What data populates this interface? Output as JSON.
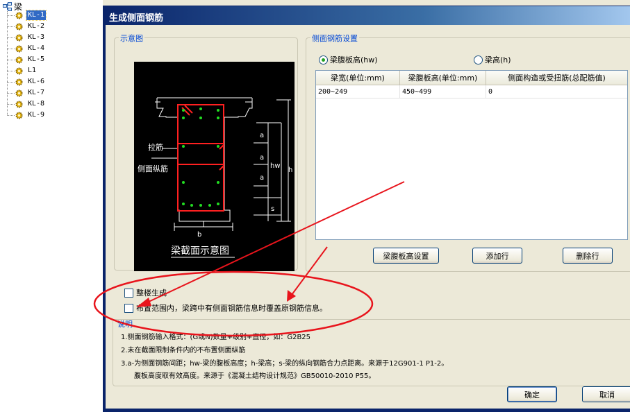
{
  "tree": {
    "root_label": "梁",
    "items": [
      {
        "label": "KL-1",
        "selected": true
      },
      {
        "label": "KL-2"
      },
      {
        "label": "KL-3"
      },
      {
        "label": "KL-4"
      },
      {
        "label": "KL-5"
      },
      {
        "label": "L1"
      },
      {
        "label": "KL-6"
      },
      {
        "label": "KL-7"
      },
      {
        "label": "KL-8"
      },
      {
        "label": "KL-9"
      }
    ]
  },
  "dialog": {
    "title": "生成侧面钢筋",
    "schematic": {
      "group_title": "示意图",
      "label_tie": "拉筋",
      "label_side_bar": "侧面纵筋",
      "caption": "梁截面示意图",
      "dim_a": "a",
      "dim_hw": "hw",
      "dim_h": "h",
      "dim_s": "s",
      "dim_b": "b"
    },
    "settings": {
      "group_title": "侧面钢筋设置",
      "radio_web_height": "梁腹板高(hw)",
      "radio_beam_height": "梁高(h)",
      "selected_radio": "web_height",
      "table": {
        "headers": [
          "梁宽(单位:mm)",
          "梁腹板高(单位:mm)",
          "侧面构造或受扭筋(总配筋值)"
        ],
        "rows": [
          [
            "200~249",
            "450~499",
            "0"
          ]
        ]
      },
      "btn_web_height_setting": "梁腹板高设置",
      "btn_add_row": "添加行",
      "btn_delete_row": "删除行"
    },
    "options": {
      "whole_floor": "整楼生成",
      "overwrite": "布置范围内，梁跨中有侧面钢筋信息时覆盖原钢筋信息。"
    },
    "notes": {
      "title": "说明",
      "lines": [
        "1.侧面钢筋输入格式：(G或N)数量+级别+直径，如：G2B25",
        "2.未在截面限制条件内的不布置侧面纵筋",
        "3.a-为侧面钢筋间距；hw-梁的腹板高度；h-梁高；s-梁的纵向钢筋合力点距离。来源于12G901-1 P1-2。",
        "腹板高度取有效高度。来源于《混凝土结构设计规范》GB50010-2010 P55。"
      ]
    },
    "btn_ok": "确定",
    "btn_cancel": "取消"
  },
  "colors": {
    "title_bar": "#0a246a",
    "group_title": "#0046d5",
    "annotation_red": "#e8141c",
    "rebar_red": "#ff2020",
    "stirrup_dot": "#22dd22"
  }
}
